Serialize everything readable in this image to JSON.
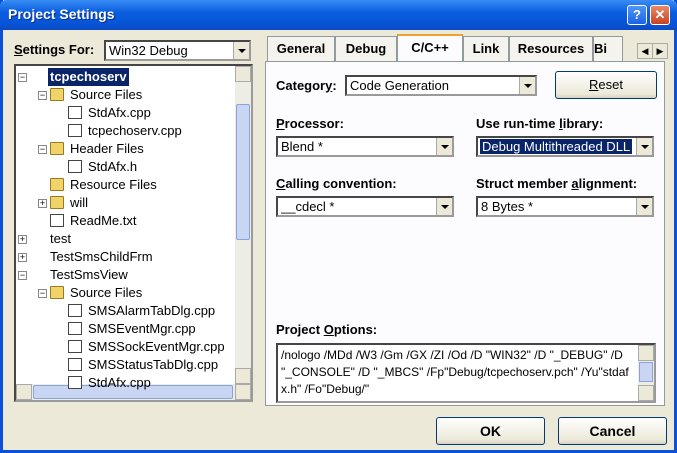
{
  "window": {
    "title": "Project Settings",
    "help_label": "?",
    "close_label": "✕"
  },
  "settings_for": {
    "label_u": "S",
    "label_rest": "ettings For:",
    "value": "Win32 Debug"
  },
  "tree": [
    {
      "label": "tcpechoserv",
      "level": 0,
      "type": "project",
      "expander": "−",
      "selected": true
    },
    {
      "label": "Source Files",
      "level": 1,
      "type": "folder",
      "expander": "−"
    },
    {
      "label": "StdAfx.cpp",
      "level": 2,
      "type": "file"
    },
    {
      "label": "tcpechoserv.cpp",
      "level": 2,
      "type": "file"
    },
    {
      "label": "Header Files",
      "level": 1,
      "type": "folder",
      "expander": "−"
    },
    {
      "label": "StdAfx.h",
      "level": 2,
      "type": "file"
    },
    {
      "label": "Resource Files",
      "level": 1,
      "type": "folder"
    },
    {
      "label": "will",
      "level": 1,
      "type": "folder",
      "expander": "+"
    },
    {
      "label": "ReadMe.txt",
      "level": 1,
      "type": "file"
    },
    {
      "label": "test",
      "level": 0,
      "type": "project",
      "expander": "+"
    },
    {
      "label": "TestSmsChildFrm",
      "level": 0,
      "type": "project",
      "expander": "+"
    },
    {
      "label": "TestSmsView",
      "level": 0,
      "type": "project",
      "expander": "−"
    },
    {
      "label": "Source Files",
      "level": 1,
      "type": "folder",
      "expander": "−"
    },
    {
      "label": "SMSAlarmTabDlg.cpp",
      "level": 2,
      "type": "file"
    },
    {
      "label": "SMSEventMgr.cpp",
      "level": 2,
      "type": "file"
    },
    {
      "label": "SMSSockEventMgr.cpp",
      "level": 2,
      "type": "file"
    },
    {
      "label": "SMSStatusTabDlg.cpp",
      "level": 2,
      "type": "file"
    },
    {
      "label": "StdAfx.cpp",
      "level": 2,
      "type": "file"
    }
  ],
  "tabs": [
    {
      "label": "General",
      "active": false
    },
    {
      "label": "Debug",
      "active": false
    },
    {
      "label": "C/C++",
      "active": true
    },
    {
      "label": "Link",
      "active": false
    },
    {
      "label": "Resources",
      "active": false
    },
    {
      "label": "Bi",
      "active": false
    }
  ],
  "category": {
    "label_pre": "Categor",
    "label_u": "y",
    "label_post": ":",
    "value": "Code Generation"
  },
  "reset_button": {
    "label_u": "R",
    "label_rest": "eset"
  },
  "processor": {
    "label_u": "P",
    "label_rest": "rocessor:",
    "value": "Blend *"
  },
  "runtime_library": {
    "label_pre": "Use run-time ",
    "label_u": "l",
    "label_rest": "ibrary:",
    "value": "Debug Multithreaded DLL"
  },
  "calling_convention": {
    "label_u": "C",
    "label_rest": "alling convention:",
    "value": "__cdecl *"
  },
  "struct_alignment": {
    "label_pre": "Struct member ",
    "label_u": "a",
    "label_rest": "lignment:",
    "value": "8 Bytes *"
  },
  "project_options": {
    "label_pre": "Project ",
    "label_u": "O",
    "label_rest": "ptions:",
    "text": "/nologo /MDd /W3 /Gm /GX /ZI /Od /D \"WIN32\" /D \"_DEBUG\" /D \"_CONSOLE\" /D \"_MBCS\" /Fp\"Debug/tcpechoserv.pch\" /Yu\"stdafx.h\" /Fo\"Debug/\""
  },
  "ok_button": "OK",
  "cancel_button": "Cancel"
}
